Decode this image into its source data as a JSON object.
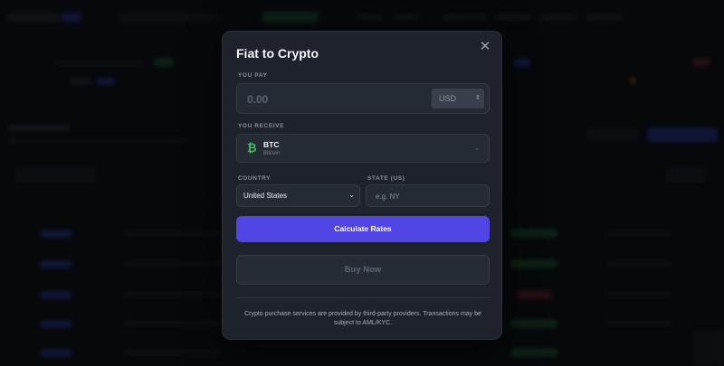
{
  "modal": {
    "title": "Fiat to Crypto",
    "close_icon": "close-icon",
    "pay": {
      "label": "YOU PAY",
      "amount_placeholder": "0.00",
      "currency": "USD"
    },
    "receive": {
      "label": "YOU RECEIVE",
      "asset_symbol": "BTC",
      "asset_name": "Bitcoin",
      "asset_icon": "bitcoin-icon"
    },
    "country": {
      "label": "COUNTRY",
      "selected": "United States"
    },
    "state": {
      "label": "STATE (US)",
      "placeholder": "e.g. NY"
    },
    "calculate_label": "Calculate Rates",
    "buy_label": "Buy Now",
    "disclaimer": "Crypto purchase services are provided by third-party providers. Transactions may be subject to AML/KYC."
  },
  "colors": {
    "accent": "#5046e5",
    "modal_bg": "#1d222b",
    "bitcoin": "#3fbf62"
  }
}
